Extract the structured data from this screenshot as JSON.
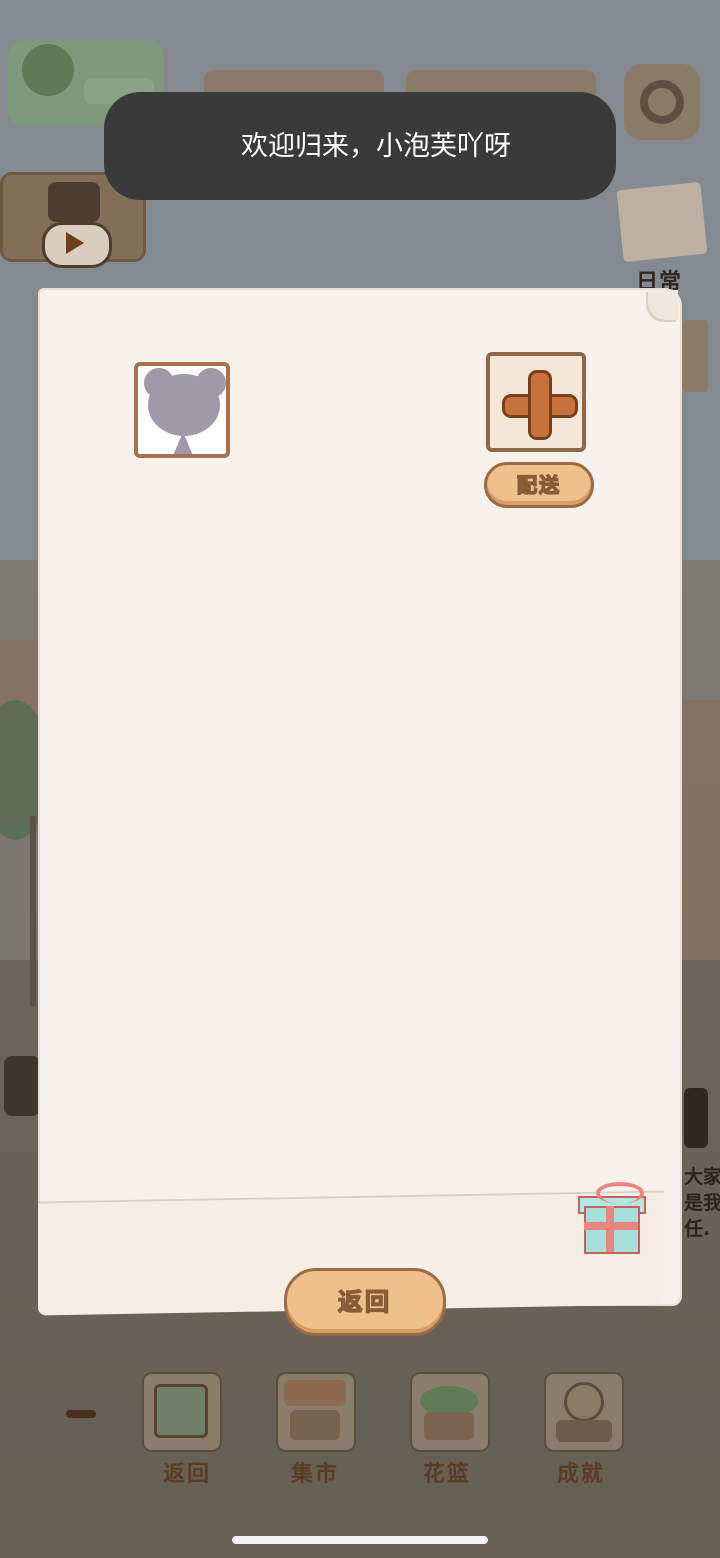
{
  "toast": {
    "message": "欢迎归来，小泡芙吖呀"
  },
  "topbar": {
    "daily_label": "日常"
  },
  "panel": {
    "deliver_label": "配送",
    "back_label": "返回"
  },
  "background_chat": {
    "lines": [
      "大家",
      "是我",
      "任."
    ]
  },
  "bottom_nav": {
    "items": [
      {
        "label": "返回"
      },
      {
        "label": "集市"
      },
      {
        "label": "花篮"
      },
      {
        "label": "成就"
      }
    ]
  },
  "colors": {
    "toast_bg": "#3a3a3a",
    "paper": "#f6f1ea",
    "button_orange": "#f0c08c",
    "button_border": "#9c6a43",
    "plus_orange": "#c8723e"
  }
}
